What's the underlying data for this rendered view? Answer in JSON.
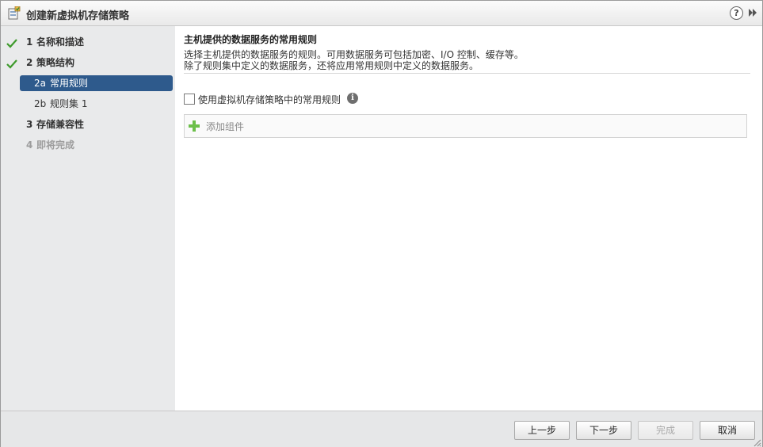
{
  "window": {
    "title": "创建新虚拟机存储策略",
    "help_glyph": "?",
    "title_icon": "storage-policy-icon",
    "help_icon": "help-icon",
    "expand_icon": "double-chevron-right-icon"
  },
  "nav": {
    "items": [
      {
        "number": "1",
        "label": "名称和描述",
        "status": "completed",
        "icon": "checkmark-icon"
      },
      {
        "number": "2",
        "label": "策略结构",
        "status": "completed",
        "icon": "checkmark-icon"
      },
      {
        "number": "2a",
        "label": "常用规则",
        "status": "active"
      },
      {
        "number": "2b",
        "label": "规则集 1",
        "status": "pending"
      },
      {
        "number": "3",
        "label": "存储兼容性",
        "status": "pending"
      },
      {
        "number": "4",
        "label": "即将完成",
        "status": "disabled"
      }
    ],
    "accent_color": "#2e5a8c",
    "check_color": "#3e9a2c"
  },
  "main": {
    "title": "主机提供的数据服务的常用规则",
    "description_line1": "选择主机提供的数据服务的规则。可用数据服务可包括加密、I/O 控制、缓存等。",
    "description_line2": "除了规则集中定义的数据服务，还将应用常用规则中定义的数据服务。",
    "use_common_rules_label": "使用虚拟机存储策略中的常用规则",
    "use_common_rules_checked": false,
    "info_glyph": "i",
    "add_component_label": "添加组件",
    "add_icon": "plus-icon"
  },
  "footer": {
    "back_label": "上一步",
    "next_label": "下一步",
    "finish_label": "完成",
    "cancel_label": "取消",
    "finish_enabled": false
  }
}
